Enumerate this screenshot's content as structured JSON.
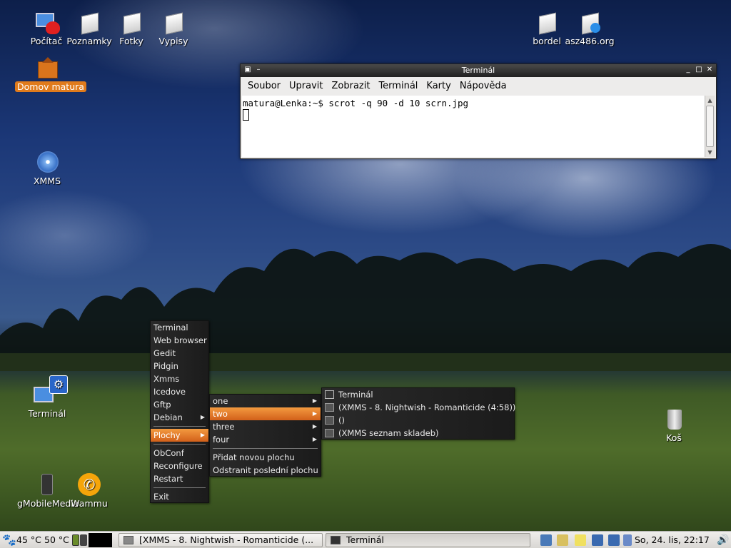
{
  "desktop": {
    "icons": {
      "pocitac": "Počítač",
      "poznamky": "Poznamky",
      "fotky": "Fotky",
      "vypisy": "Vypisy",
      "domov": "Domov matura",
      "xmms": "XMMS",
      "bordel": "bordel",
      "asz": "asz486.org",
      "terminal": "Terminál",
      "gmobile": "gMobileMedia",
      "wammu": "Wammu",
      "kos": "Koš"
    }
  },
  "terminal_window": {
    "title": "Terminál",
    "menu": [
      "Soubor",
      "Upravit",
      "Zobrazit",
      "Terminál",
      "Karty",
      "Nápověda"
    ],
    "prompt": "matura@Lenka:~$ scrot -q 90 -d 10 scrn.jpg"
  },
  "root_menu": {
    "items": [
      "Terminal",
      "Web browser",
      "Gedit",
      "Pidgin",
      "Xmms",
      "Icedove",
      "Gftp",
      "Debian"
    ],
    "plochy": "Plochy",
    "items2": [
      "ObConf",
      "Reconfigure",
      "Restart"
    ],
    "exit": "Exit"
  },
  "desktops_menu": {
    "items": [
      "one",
      "two",
      "three",
      "four"
    ],
    "add": "Přidat novou plochu",
    "remove": "Odstranit poslední plochu"
  },
  "windows_menu": {
    "items": [
      "Terminál",
      "(XMMS - 8. Nightwish - Romanticide (4:58))",
      "()",
      "(XMMS seznam skladeb)"
    ]
  },
  "taskbar": {
    "temp1": "45 °C",
    "temp2": "50 °C",
    "task1": "[XMMS - 8. Nightwish - Romanticide (...",
    "task2": "Terminál",
    "clock": "So, 24. lis, 22:17"
  },
  "colors": {
    "selection_orange": "#e07b1c",
    "menu_bg": "#222222"
  }
}
